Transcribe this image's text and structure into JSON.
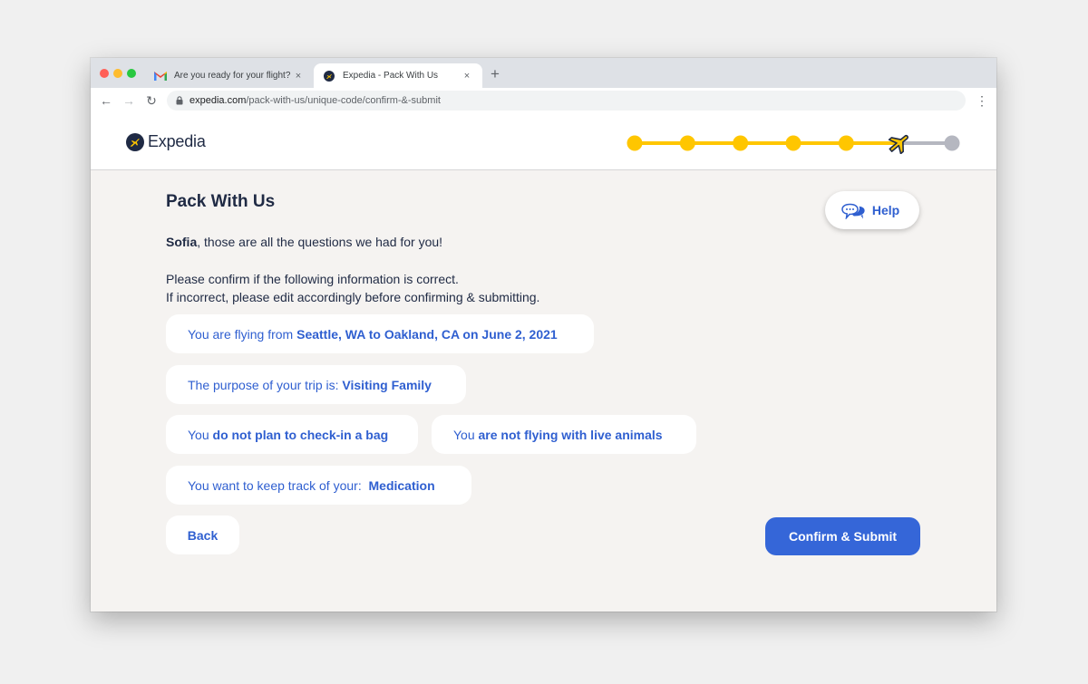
{
  "browser": {
    "tabs": [
      {
        "title": "Are you ready for your flight?",
        "icon": "gmail-icon",
        "close": "×"
      },
      {
        "title": "Expedia - Pack With Us",
        "icon": "expedia-favicon",
        "close": "×"
      }
    ],
    "new_tab": "+",
    "url_host": "expedia.com",
    "url_path": "/pack-with-us/unique-code/confirm-&-submit",
    "back": "←",
    "forward": "→",
    "reload": "↻",
    "menu": "⋮"
  },
  "header": {
    "logo_text": "Expedia",
    "progress": {
      "completed_steps": 6,
      "total_steps": 7,
      "current_icon": "airplane-icon"
    }
  },
  "colors": {
    "accent": "#2f5fd0",
    "button": "#3566d8",
    "progress_done": "#ffc600",
    "progress_todo": "#b5b7c0",
    "text_dark": "#1f2a44",
    "background": "#f5f3f1"
  },
  "main": {
    "title": "Pack With Us",
    "help_label": "Help",
    "greeting_name": "Sofia",
    "greeting_rest": ", those are all the questions we had for you!",
    "confirm_line1": "Please confirm if the following information is correct.",
    "confirm_line2": "If incorrect, please edit accordingly before confirming & submitting.",
    "flight": {
      "prefix": "You are flying from ",
      "value": "Seattle, WA to Oakland, CA on June 2, 2021"
    },
    "purpose": {
      "prefix": "The purpose of your trip is: ",
      "value": "Visiting Family"
    },
    "bag": {
      "prefix": "You ",
      "value": "do not plan to check-in a bag"
    },
    "animals": {
      "prefix": "You ",
      "value": "are not flying with live animals"
    },
    "track": {
      "prefix": "You want to keep track of your:  ",
      "value": "Medication"
    },
    "back_label": "Back",
    "submit_label": "Confirm & Submit"
  }
}
